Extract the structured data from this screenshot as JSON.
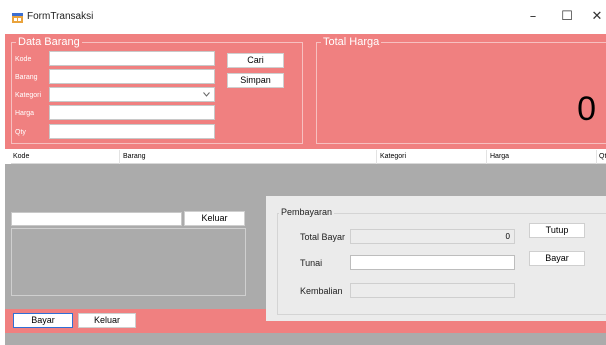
{
  "window": {
    "title": "FormTransaksi",
    "controls": [
      "–",
      "☐",
      "✕"
    ]
  },
  "data_barang": {
    "legend": "Data Barang",
    "fields": [
      {
        "label": "Kode",
        "value": ""
      },
      {
        "label": "Barang",
        "value": ""
      },
      {
        "label": "Kategori",
        "value": ""
      },
      {
        "label": "Harga",
        "value": ""
      },
      {
        "label": "Qty",
        "value": ""
      }
    ],
    "cari_label": "Cari",
    "simpan_label": "Simpan"
  },
  "total_harga": {
    "legend": "Total Harga",
    "value": "0"
  },
  "grid": {
    "columns": [
      "Kode",
      "Barang",
      "Kategori",
      "Harga",
      "Qt"
    ]
  },
  "left_panel": {
    "search_value": "",
    "keluar_label": "Keluar"
  },
  "pembayaran": {
    "legend": "Pembayaran",
    "total_bayar_label": "Total Bayar",
    "total_bayar_value": "0",
    "tunai_label": "Tunai",
    "tunai_value": "",
    "kembalian_label": "Kembalian",
    "kembalian_value": "",
    "tutup_label": "Tutup",
    "bayar_label": "Bayar"
  },
  "bottom": {
    "bayar_label": "Bayar",
    "keluar_label": "Keluar"
  },
  "colors": {
    "accent": "#f08080",
    "gray": "#ababab",
    "panel": "#ebebeb"
  },
  "icons": {
    "app": "form-app-icon",
    "dropdown": "chevron-down-icon"
  }
}
